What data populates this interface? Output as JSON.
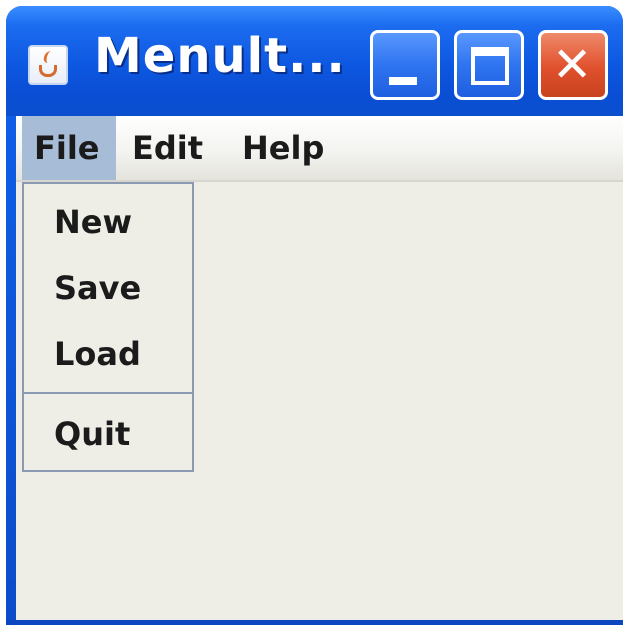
{
  "window": {
    "title": "Menult...",
    "icon": "java-cup-icon",
    "controls": {
      "minimize_icon": "minimize-icon",
      "maximize_icon": "maximize-icon",
      "close_glyph": "✕"
    }
  },
  "menubar": {
    "items": [
      {
        "label": "File",
        "active": true
      },
      {
        "label": "Edit",
        "active": false
      },
      {
        "label": "Help",
        "active": false
      }
    ]
  },
  "file_menu": {
    "items": [
      {
        "label": "New"
      },
      {
        "label": "Save"
      },
      {
        "label": "Load"
      },
      {
        "label": "Quit"
      }
    ]
  },
  "colors": {
    "titlebar": "#0d57e0",
    "close_button": "#e0502d",
    "menu_highlight": "#a7bcd6",
    "client_background": "#eeede6"
  }
}
